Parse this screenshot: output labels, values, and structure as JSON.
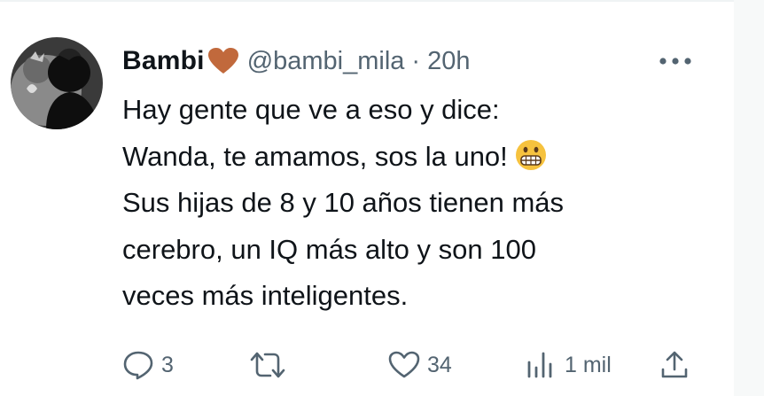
{
  "tweet": {
    "author_name": "Bambi",
    "author_handle": "@bambi_mila",
    "separator": "·",
    "time": "20h",
    "text_lines": [
      "Hay gente que ve a eso y dice:",
      "Wanda, te amamos, sos la uno!",
      "Sus hijas de 8 y 10 años tienen más",
      "cerebro, un IQ más alto y son 100",
      "veces más inteligentes."
    ],
    "actions": {
      "replies": "3",
      "retweets": "",
      "likes": "34",
      "views": "1 mil"
    }
  },
  "icons": {
    "avatar": "avatar-silhouette-icon",
    "name_emoji": "brown-heart-icon",
    "text_emoji": "grimacing-face-icon",
    "more": "more-dots-icon",
    "reply": "reply-bubble-icon",
    "retweet": "retweet-icon",
    "like": "heart-outline-icon",
    "views": "views-bar-chart-icon",
    "share": "share-upload-icon"
  },
  "colors": {
    "text": "#0f1419",
    "secondary": "#536471",
    "heart_emoji": "#c1693c",
    "grimace_emoji": "#f6c23e"
  }
}
